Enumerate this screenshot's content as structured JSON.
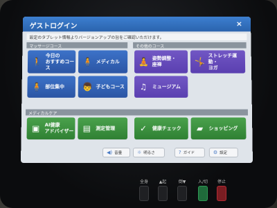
{
  "window": {
    "title": "ゲストログイン",
    "close": "×"
  },
  "notice": "設定のタブレット情報よりバージョンアップの旨をご確認いただけます。",
  "sections": {
    "massage": "マッサージコース",
    "other": "その他のコース",
    "medical": "メディカルケア"
  },
  "massage_tiles": [
    {
      "label": "今日の\nおすすめコース",
      "icon": "person-walking-icon"
    },
    {
      "label": "メディカル",
      "icon": "body-icon"
    },
    {
      "label": "部位集中",
      "icon": "body-part-icon"
    },
    {
      "label": "子どもコース",
      "icon": "child-icon"
    }
  ],
  "other_tiles": [
    {
      "label": "姿勢調整・\n座禅",
      "icon": "posture-icon"
    },
    {
      "label": "ストレッチ運動・\nヨガ",
      "icon": "stretch-icon"
    },
    {
      "label": "ミュージアム",
      "icon": "music-icon"
    }
  ],
  "medical_tiles": [
    {
      "label": "AI健康\nアドバイザー",
      "icon": "ai-icon"
    },
    {
      "label": "測定管理",
      "icon": "clipboard-icon"
    },
    {
      "label": "健康チェック",
      "icon": "check-icon"
    },
    {
      "label": "ショッピング",
      "icon": "bag-icon"
    }
  ],
  "bottom_bar": {
    "volume": "音量",
    "brightness": "明るさ",
    "guide": "ガイド",
    "settings": "設定"
  },
  "hardware": {
    "all_body": "全身",
    "up": "▲起",
    "down": "倒▼",
    "power": "入/切",
    "stop": "停止"
  },
  "colors": {
    "accent": "#2a63ad",
    "massage_tile": "#3c72c8",
    "other_tile": "#7157c4",
    "medical_tile": "#4aa14c"
  }
}
